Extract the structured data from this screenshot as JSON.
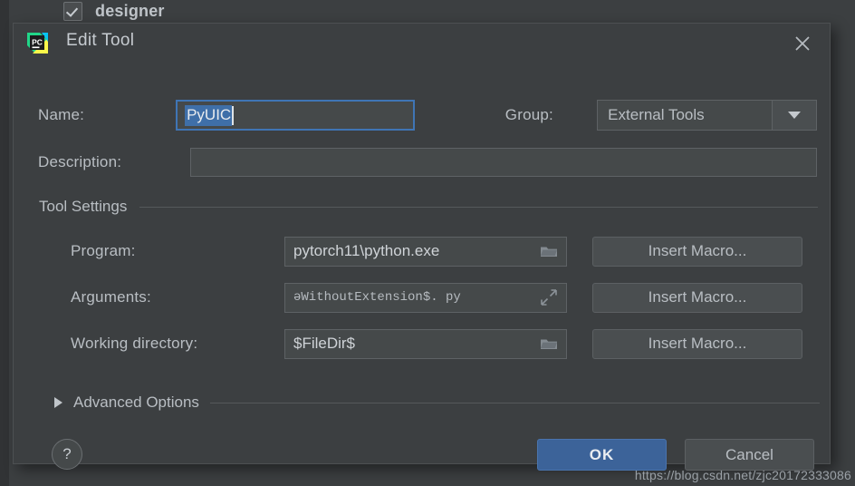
{
  "background": {
    "checkbox_item": {
      "label": "designer",
      "checked": true
    }
  },
  "dialog": {
    "app_icon": "pycharm-icon",
    "title": "Edit Tool",
    "close_icon": "close-icon",
    "name": {
      "label": "Name:",
      "value": "PyUIC",
      "selected": true,
      "focused": true
    },
    "group": {
      "label": "Group:",
      "value": "External Tools",
      "dropdown_icon": "chevron-down-icon"
    },
    "description": {
      "label": "Description:",
      "value": "",
      "placeholder": ""
    },
    "tool_settings": {
      "section_title": "Tool Settings",
      "rows": [
        {
          "label": "Program:",
          "value": "pytorch11\\python.exe",
          "field_icon": "folder-icon",
          "button_label": "Insert Macro..."
        },
        {
          "label": "Arguments:",
          "value": "ǝWithoutExtension$. py",
          "field_icon": "expand-diagonal-icon",
          "button_label": "Insert Macro...",
          "monospace": true
        },
        {
          "label": "Working directory:",
          "value": "$FileDir$",
          "field_icon": "folder-icon",
          "button_label": "Insert Macro..."
        }
      ]
    },
    "advanced_options": {
      "label": "Advanced Options",
      "expanded": false,
      "toggle_icon": "triangle-right-icon"
    },
    "footer": {
      "help_label": "?",
      "ok_label": "OK",
      "cancel_label": "Cancel"
    }
  },
  "watermark": "https://blog.csdn.net/zjc20172333086",
  "colors": {
    "dialog_bg": "#3c3f41",
    "field_bg": "#45494a",
    "focus_border": "#3f75b5",
    "selection_bg": "#3f6fa8",
    "ok_button": "#3c6399",
    "text": "#b9bec3"
  }
}
